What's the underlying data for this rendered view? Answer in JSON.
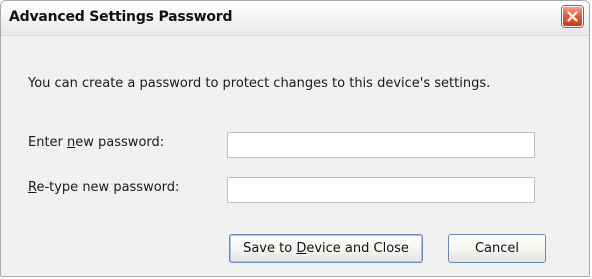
{
  "window": {
    "title": "Advanced Settings Password",
    "close_icon": "close-icon"
  },
  "dialog": {
    "intro_text": "You can create a password to protect changes to this device's settings.",
    "new_password_label_pre": "Enter ",
    "new_password_label_accel": "n",
    "new_password_label_post": "ew password:",
    "new_password_value": "",
    "retype_label_pre": "",
    "retype_label_accel": "R",
    "retype_label_post": "e-type new password:",
    "retype_value": ""
  },
  "buttons": {
    "save_pre": "Save to ",
    "save_accel": "D",
    "save_post": "evice and Close",
    "cancel_label": "Cancel"
  },
  "colors": {
    "close_button": "#d9542f",
    "dialog_background": "#f1f1ef",
    "button_border": "#6f88b8"
  }
}
